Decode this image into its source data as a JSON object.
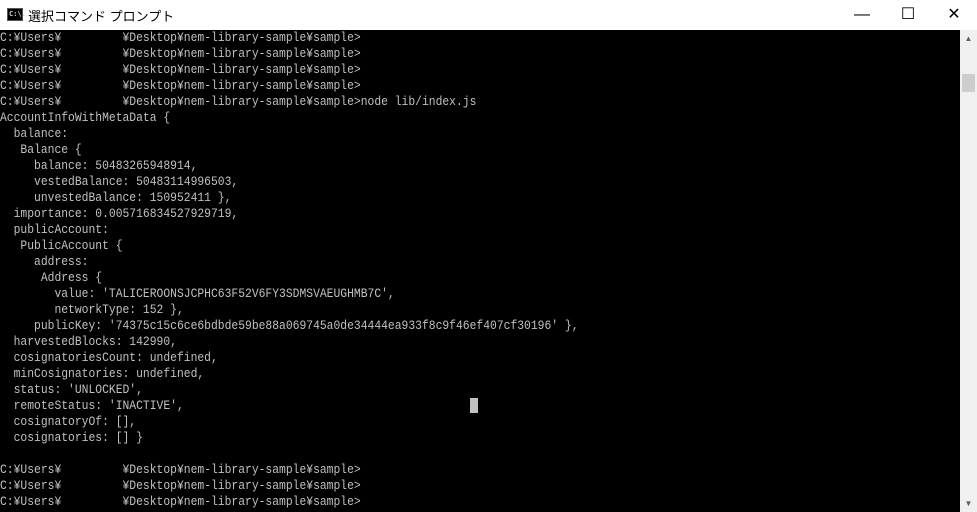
{
  "window": {
    "title": "選択コマンド プロンプト",
    "icon": "cmd-icon",
    "icon_text": "C:\\.",
    "minimize": "—",
    "maximize": "☐",
    "close": "✕"
  },
  "console": {
    "lines": [
      "C:¥Users¥         ¥Desktop¥nem-library-sample¥sample>",
      "C:¥Users¥         ¥Desktop¥nem-library-sample¥sample>",
      "C:¥Users¥         ¥Desktop¥nem-library-sample¥sample>",
      "C:¥Users¥         ¥Desktop¥nem-library-sample¥sample>",
      "C:¥Users¥         ¥Desktop¥nem-library-sample¥sample>node lib/index.js",
      "AccountInfoWithMetaData {",
      "  balance:",
      "   Balance {",
      "     balance: 50483265948914,",
      "     vestedBalance: 50483114996503,",
      "     unvestedBalance: 150952411 },",
      "  importance: 0.005716834527929719,",
      "  publicAccount:",
      "   PublicAccount {",
      "     address:",
      "      Address {",
      "        value: 'TALICEROONSJCPHC63F52V6FY3SDMSVAEUGHMB7C',",
      "        networkType: 152 },",
      "     publicKey: '74375c15c6ce6bdbde59be88a069745a0de34444ea933f8c9f46ef407cf30196' },",
      "  harvestedBlocks: 142990,",
      "  cosignatoriesCount: undefined,",
      "  minCosignatories: undefined,",
      "  status: 'UNLOCKED',",
      "  remoteStatus: 'INACTIVE',",
      "  cosignatoryOf: [],",
      "  cosignatories: [] }",
      "",
      "C:¥Users¥         ¥Desktop¥nem-library-sample¥sample>",
      "C:¥Users¥         ¥Desktop¥nem-library-sample¥sample>",
      "C:¥Users¥         ¥Desktop¥nem-library-sample¥sample>"
    ]
  },
  "scrollbar": {
    "up_arrow": "▲",
    "down_arrow": "▼"
  }
}
